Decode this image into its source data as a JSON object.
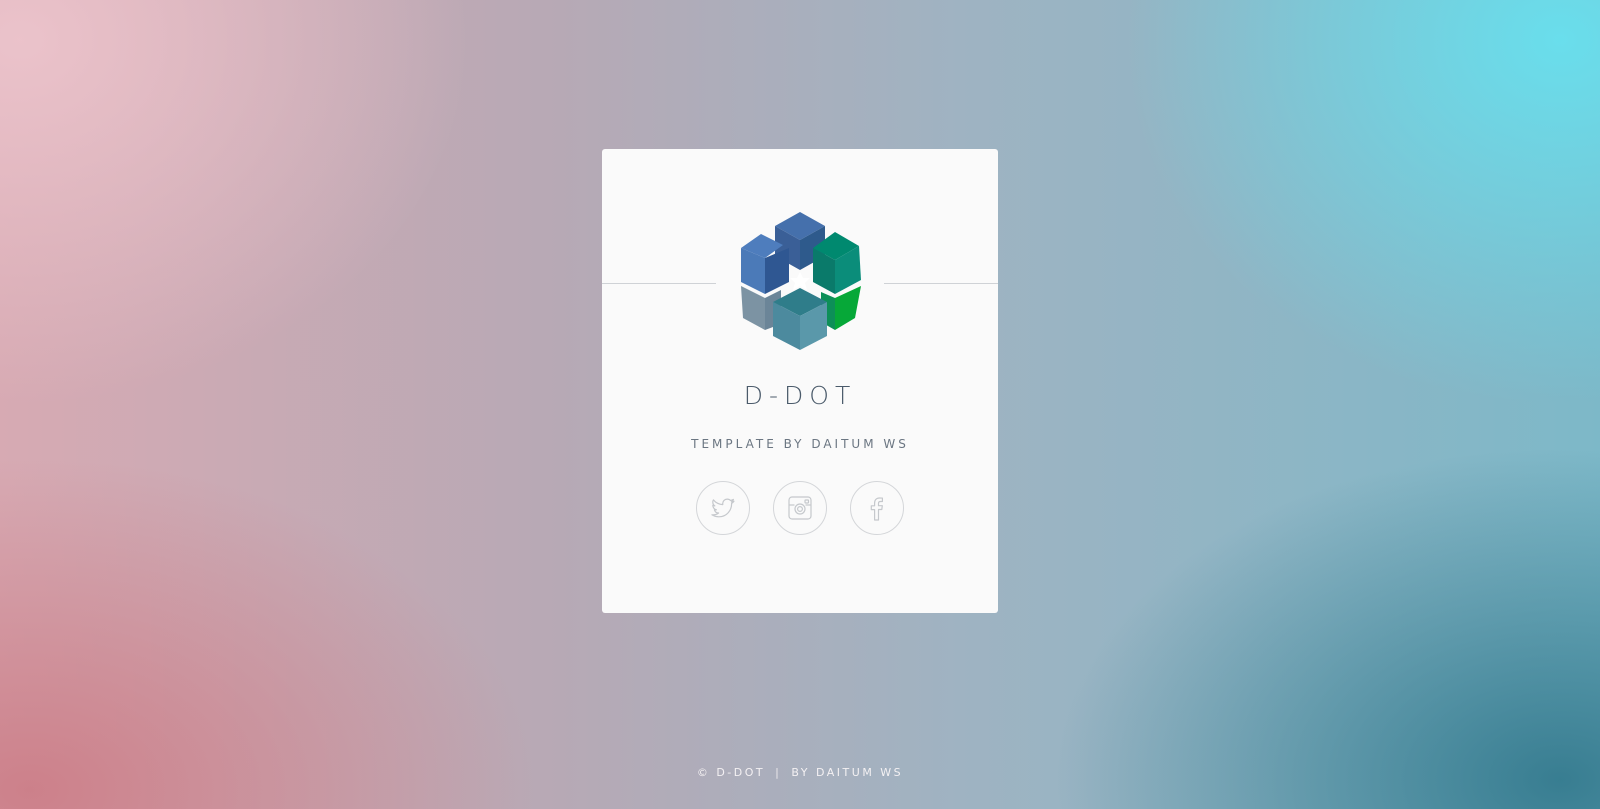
{
  "card": {
    "title": "D-DOT",
    "subtitle": "TEMPLATE BY DAITUM WS"
  },
  "logo": {
    "icon": "cube-cluster-logo",
    "colors": [
      "#3f67a6",
      "#4e7dbd",
      "#00886e",
      "#05a437",
      "#7a8fa0",
      "#4a8b9d"
    ]
  },
  "socials": [
    {
      "icon": "twitter-icon",
      "label": "Twitter"
    },
    {
      "icon": "instagram-icon",
      "label": "Instagram"
    },
    {
      "icon": "facebook-icon",
      "label": "Facebook"
    }
  ],
  "footer": {
    "copyright": "© D-DOT",
    "separator": "|",
    "credit": "BY DAITUM WS"
  },
  "colors": {
    "card_background": "#fafafa",
    "title_text": "#4a5a6a",
    "icon_stroke": "#c9ccd0"
  }
}
